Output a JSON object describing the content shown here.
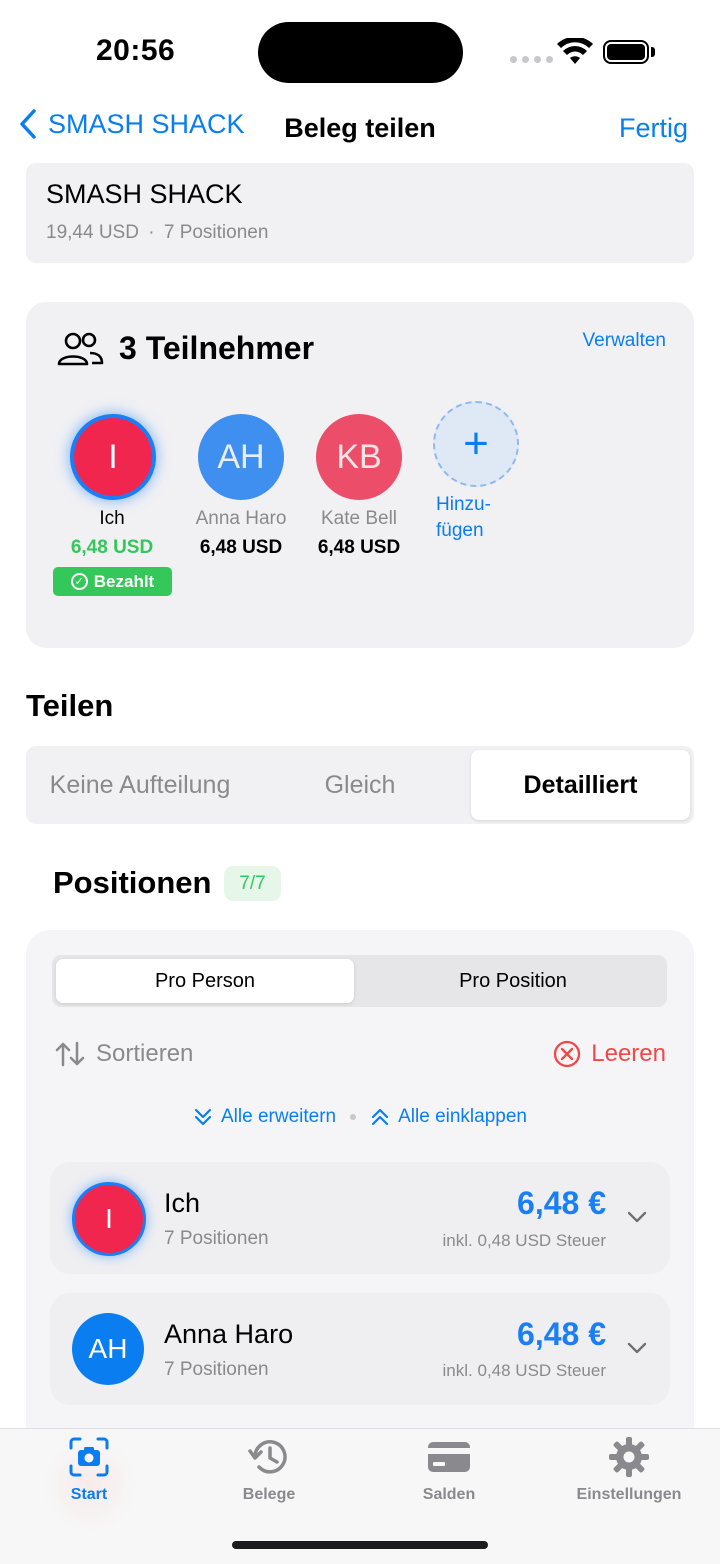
{
  "status_bar": {
    "time": "20:56"
  },
  "nav": {
    "back_label": "SMASH SHACK",
    "title": "Beleg teilen",
    "done_label": "Fertig"
  },
  "receipt": {
    "merchant": "SMASH SHACK",
    "total": "19,44 USD",
    "separator": "·",
    "positions": "7 Positionen"
  },
  "participants": {
    "title": "3 Teilnehmer",
    "manage_label": "Verwalten",
    "people": [
      {
        "initials": "I",
        "name": "Ich",
        "amount": "6,48 USD",
        "badge": "Bezahlt",
        "color": "#f0264f"
      },
      {
        "initials": "AH",
        "name": "Anna Haro",
        "amount": "6,48 USD",
        "color": "#3e8ff0"
      },
      {
        "initials": "KB",
        "name": "Kate Bell",
        "amount": "6,48 USD",
        "color": "#ec4e69"
      }
    ],
    "add_icon": "+",
    "add_label_1": "Hinzu-",
    "add_label_2": "fügen"
  },
  "split": {
    "heading": "Teilen",
    "options": [
      "Keine Aufteilung",
      "Gleich",
      "Detailliert"
    ],
    "selected": "Detailliert"
  },
  "positions": {
    "heading": "Positionen",
    "badge": "7/7",
    "view_options": [
      "Pro Person",
      "Pro Position"
    ],
    "selected_view": "Pro Person",
    "sort_label": "Sortieren",
    "clear_label": "Leeren",
    "expand_all": "Alle erweitern",
    "collapse_all": "Alle einklappen",
    "rows": [
      {
        "initials": "I",
        "name": "Ich",
        "count": "7 Positionen",
        "amount": "6,48 €",
        "tax": "inkl. 0,48 USD Steuer"
      },
      {
        "initials": "AH",
        "name": "Anna Haro",
        "count": "7 Positionen",
        "amount": "6,48 €",
        "tax": "inkl. 0,48 USD Steuer"
      }
    ]
  },
  "tabbar": {
    "tabs": [
      {
        "label": "Start",
        "icon": "camera-scan-icon",
        "active": true
      },
      {
        "label": "Belege",
        "icon": "history-icon",
        "active": false
      },
      {
        "label": "Salden",
        "icon": "card-icon",
        "active": false
      },
      {
        "label": "Einstellungen",
        "icon": "gear-icon",
        "active": false
      }
    ]
  },
  "colors": {
    "accent": "#0a7ef0",
    "paid": "#34c759",
    "destructive": "#f04848"
  }
}
